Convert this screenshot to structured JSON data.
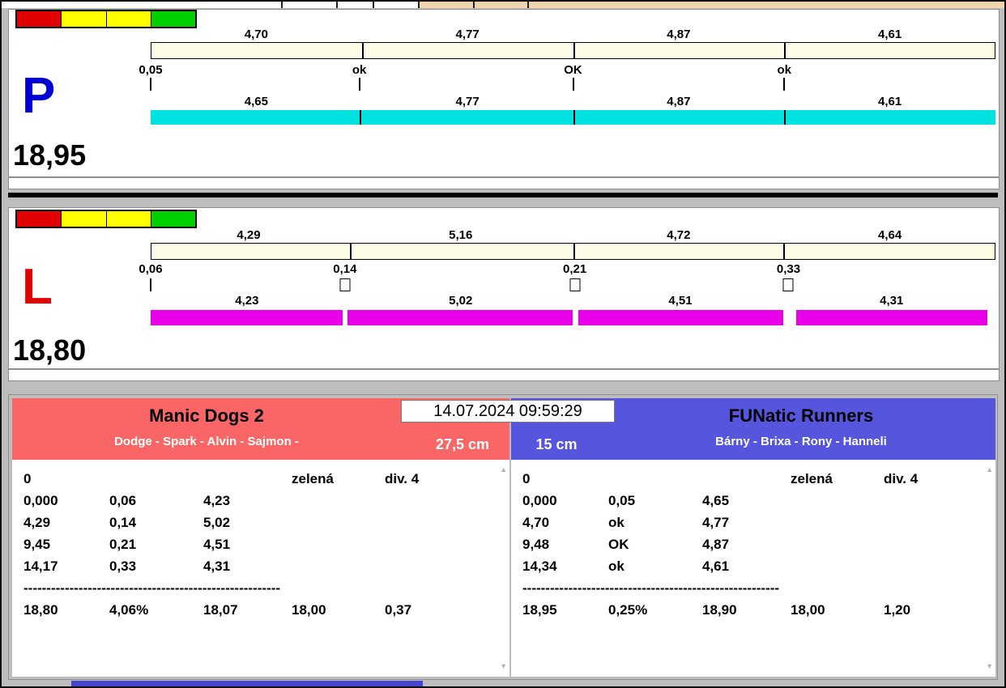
{
  "timestamp": "14.07.2024 09:59:29",
  "lanes": [
    {
      "letter": "P",
      "letter_color": "#0000d2",
      "total_time": "18,95",
      "bar_color": "#00e2e2",
      "track_color": "#fbfbe6",
      "lights": [
        "#e00000",
        "#ffff00",
        "#ffff00",
        "#00d000"
      ],
      "top_splits": [
        "4,70",
        "4,77",
        "4,87",
        "4,61"
      ],
      "markers": [
        "0,05",
        "ok",
        "OK",
        "ok"
      ],
      "bottom_splits": [
        "4,65",
        "4,77",
        "4,87",
        "4,61"
      ]
    },
    {
      "letter": "L",
      "letter_color": "#e00000",
      "total_time": "18,80",
      "bar_color": "#e800e8",
      "track_color": "#fbfbe6",
      "lights": [
        "#e00000",
        "#ffff00",
        "#ffff00",
        "#00d000"
      ],
      "top_splits": [
        "4,29",
        "5,16",
        "4,72",
        "4,64"
      ],
      "markers": [
        "0,06",
        "0,14",
        "0,21",
        "0,33"
      ],
      "bottom_splits": [
        "4,23",
        "5,02",
        "4,51",
        "4,31"
      ]
    }
  ],
  "teams": [
    {
      "name": "Manic Dogs 2",
      "members": "Dodge - Spark - Alvin - Sajmon -",
      "jump_height": "27,5 cm",
      "header_color": "#fa6666",
      "info": [
        "0",
        "zelená",
        "div. 4"
      ],
      "splits": [
        [
          "0,000",
          "0,06",
          "4,23"
        ],
        [
          "4,29",
          "0,14",
          "5,02"
        ],
        [
          "9,45",
          "0,21",
          "4,51"
        ],
        [
          "14,17",
          "0,33",
          "4,31"
        ]
      ],
      "separator": "--------------------------------------------------------",
      "summary": [
        "18,80",
        "4,06%",
        "18,07",
        "18,00",
        "0,37"
      ]
    },
    {
      "name": "FUNatic Runners",
      "members": "Bárny - Brixa - Rony - Hanneli",
      "jump_height": "15 cm",
      "header_color": "#5555dd",
      "info": [
        "0",
        "zelená",
        "div. 4"
      ],
      "splits": [
        [
          "0,000",
          "0,05",
          "4,65"
        ],
        [
          "4,70",
          "ok",
          "4,77"
        ],
        [
          "9,48",
          "OK",
          "4,87"
        ],
        [
          "14,34",
          "ok",
          "4,61"
        ]
      ],
      "separator": "--------------------------------------------------------",
      "summary": [
        "18,95",
        "0,25%",
        "18,90",
        "18,00",
        "1,20"
      ]
    }
  ],
  "scroll": {
    "up": "▲",
    "down": "▼"
  }
}
